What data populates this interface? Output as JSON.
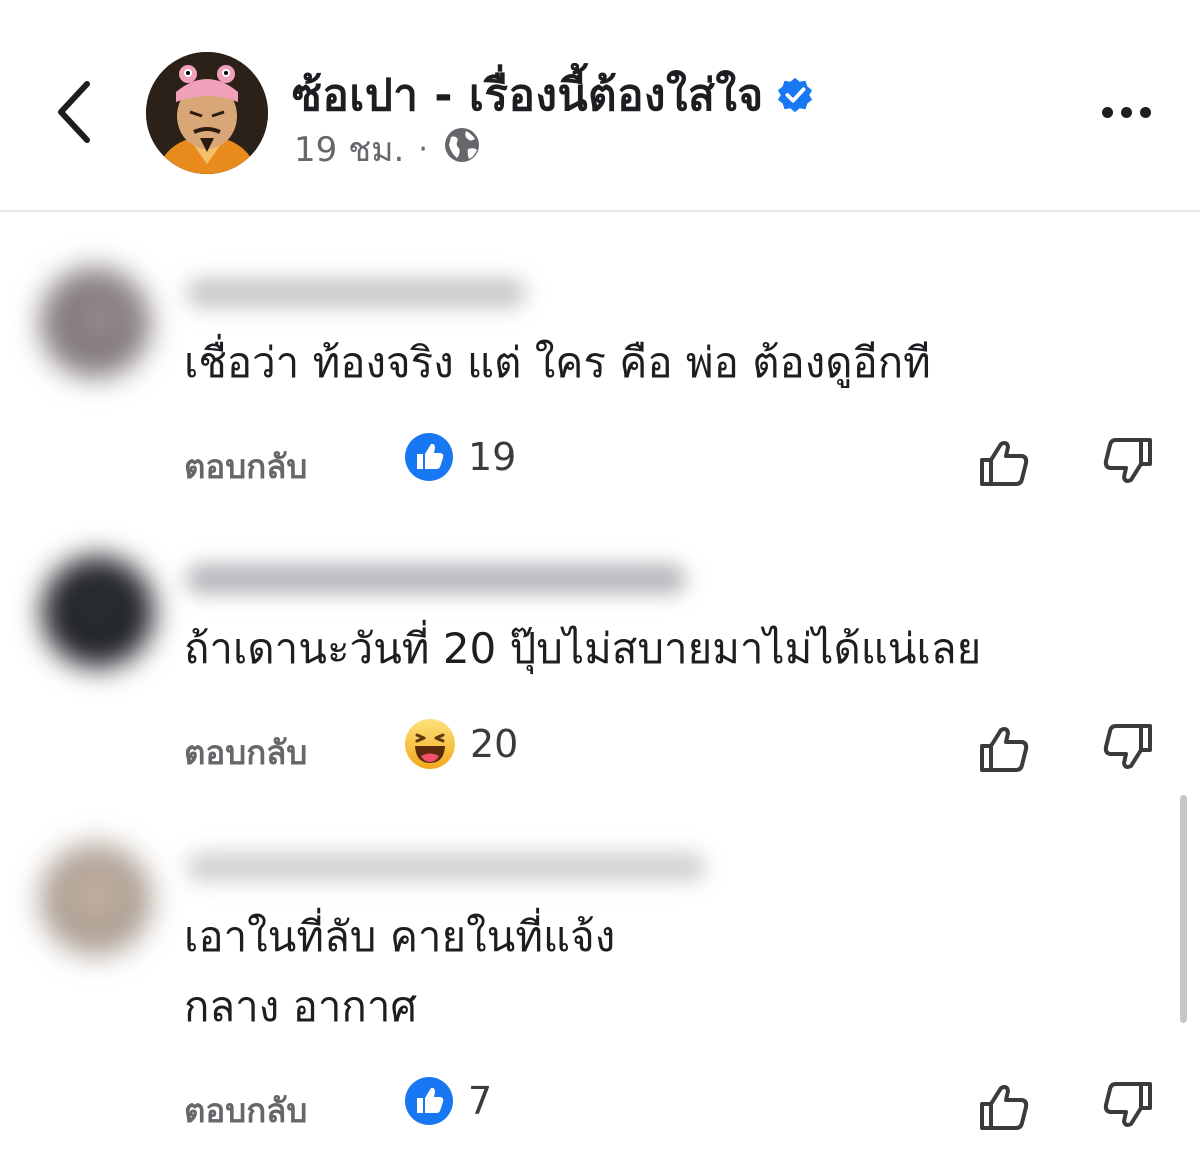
{
  "header": {
    "page_name": "ซ้อเปา - เรื่องนี้ต้องใส่ใจ",
    "time": "19 ชม.",
    "dot": "·",
    "icons": {
      "back": "chevron-left-icon",
      "verified": "verified-badge-icon",
      "audience": "globe-icon",
      "more": "more-horizontal-icon"
    },
    "verified_color": "#1877f2"
  },
  "comments": [
    {
      "text_lines": [
        "เชื่อว่า ท้องจริง แต่ ใคร คือ พ่อ ต้องดูอีกที"
      ],
      "reply_label": "ตอบกลับ",
      "reaction": "like",
      "reaction_count": "19"
    },
    {
      "text_lines": [
        "ถ้าเดานะวันที่ 20 ปุ๊บไม่สบายมาไม่ได้แน่เลย"
      ],
      "reply_label": "ตอบกลับ",
      "reaction": "haha",
      "reaction_count": "20"
    },
    {
      "text_lines": [
        "เอาในที่ลับ คายในที่แจ้ง",
        "กลาง อากาศ"
      ],
      "reply_label": "ตอบกลับ",
      "reaction": "like",
      "reaction_count": "7"
    }
  ],
  "colors": {
    "like_blue": "#1877f2",
    "haha_yellow": "#f7b928",
    "secondary_text": "#65676b"
  }
}
